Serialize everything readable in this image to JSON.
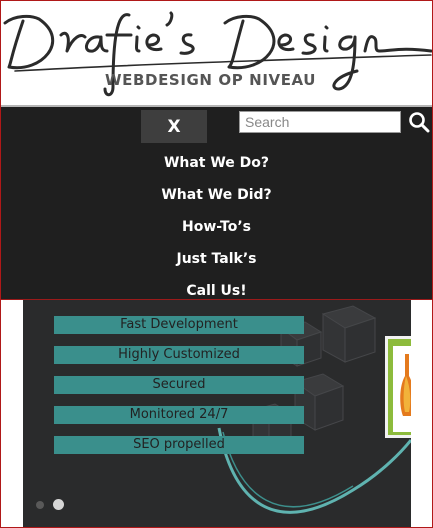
{
  "header": {
    "logo_text": "Drafie's Design",
    "tagline": "WEBDESIGN OP NIVEAU"
  },
  "menu": {
    "close_label": "X",
    "search_placeholder": "Search",
    "items": [
      {
        "label": "What We Do?"
      },
      {
        "label": "What We Did?"
      },
      {
        "label": "How-To’s"
      },
      {
        "label": "Just Talk’s"
      },
      {
        "label": "Call Us!"
      }
    ]
  },
  "hero": {
    "features": [
      "Fast Development",
      "Highly Customized",
      "Secured",
      "Monitored 24/7",
      "SEO propelled"
    ],
    "slide_count": 2,
    "active_slide": 2
  },
  "colors": {
    "menu_bg": "#1f1f1f",
    "feature_bar": "#3a8f8c",
    "accent_red": "#b01818"
  },
  "icons": {
    "search": "search-icon",
    "close": "close-icon"
  }
}
